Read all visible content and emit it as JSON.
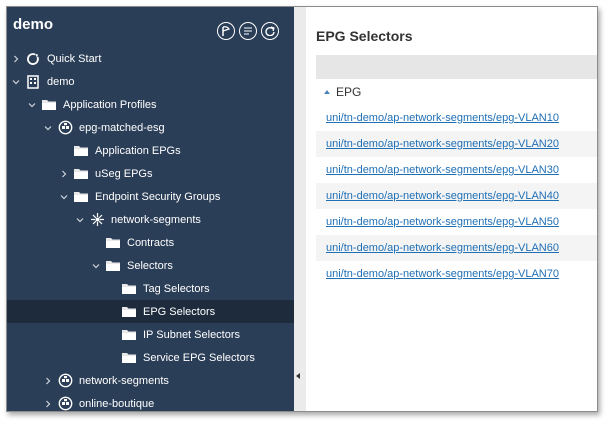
{
  "sidebar": {
    "tenant_title": "demo",
    "tree": [
      {
        "label": "Quick Start",
        "icon": "quick-start-icon",
        "chevron": "right"
      },
      {
        "label": "demo",
        "icon": "tenant-building-icon",
        "chevron": "down"
      },
      {
        "label": "Application Profiles",
        "icon": "folder-icon",
        "chevron": "down"
      },
      {
        "label": "epg-matched-esg",
        "icon": "app-profile-icon",
        "chevron": "down"
      },
      {
        "label": "Application EPGs",
        "icon": "folder-icon",
        "chevron": ""
      },
      {
        "label": "uSeg EPGs",
        "icon": "folder-icon",
        "chevron": "right"
      },
      {
        "label": "Endpoint Security Groups",
        "icon": "folder-icon",
        "chevron": "down"
      },
      {
        "label": "network-segments",
        "icon": "esg-icon",
        "chevron": "down"
      },
      {
        "label": "Contracts",
        "icon": "folder-icon",
        "chevron": ""
      },
      {
        "label": "Selectors",
        "icon": "folder-icon",
        "chevron": "down"
      },
      {
        "label": "Tag Selectors",
        "icon": "folder-icon",
        "chevron": ""
      },
      {
        "label": "EPG Selectors",
        "icon": "folder-icon",
        "chevron": "",
        "selected": true
      },
      {
        "label": "IP Subnet Selectors",
        "icon": "folder-icon",
        "chevron": ""
      },
      {
        "label": "Service EPG Selectors",
        "icon": "folder-icon",
        "chevron": ""
      },
      {
        "label": "network-segments",
        "icon": "app-profile-icon",
        "chevron": "right"
      },
      {
        "label": "online-boutique",
        "icon": "app-profile-icon",
        "chevron": "right"
      }
    ]
  },
  "main": {
    "title": "EPG Selectors",
    "column_header": "EPG",
    "rows": [
      "uni/tn-demo/ap-network-segments/epg-VLAN10",
      "uni/tn-demo/ap-network-segments/epg-VLAN20",
      "uni/tn-demo/ap-network-segments/epg-VLAN30",
      "uni/tn-demo/ap-network-segments/epg-VLAN40",
      "uni/tn-demo/ap-network-segments/epg-VLAN50",
      "uni/tn-demo/ap-network-segments/epg-VLAN60",
      "uni/tn-demo/ap-network-segments/epg-VLAN70"
    ]
  },
  "colors": {
    "sidebar_bg": "#2b3e57",
    "selected_bg": "#1d2b3d",
    "link": "#1f6fb5",
    "sort_arrow": "#4b84b6"
  }
}
